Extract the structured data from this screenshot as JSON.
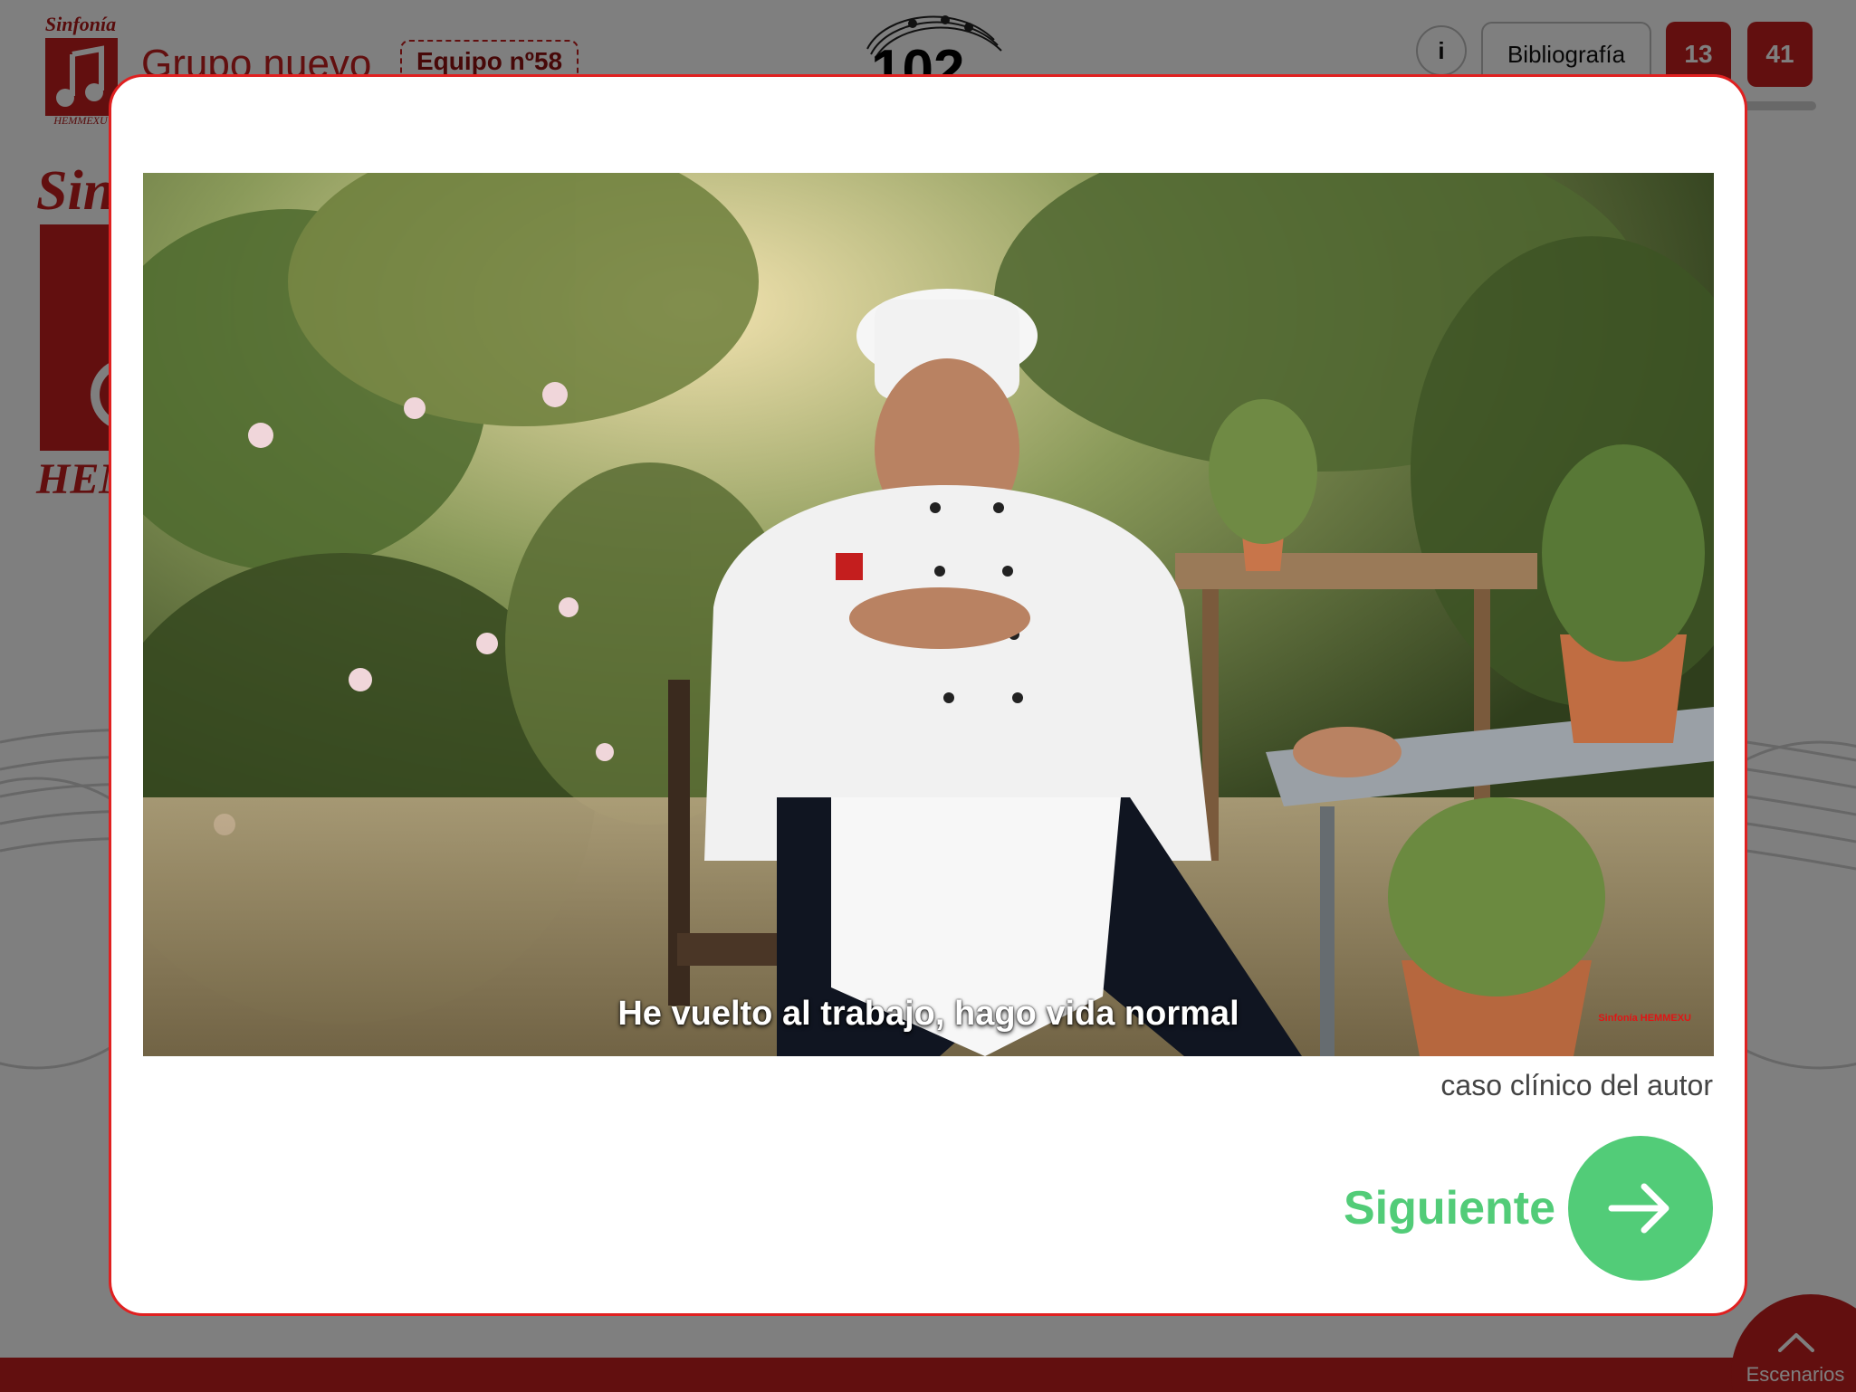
{
  "app": {
    "logo": {
      "top_text": "Sinfonía",
      "bottom_text": "HEMMEXU"
    },
    "group_title": "Grupo nuevo",
    "team_badge": "Equipo nº58",
    "counter": "102",
    "info_button": "i",
    "bibliography_button": "Bibliografía",
    "score_a": "13",
    "score_b": "41",
    "big_logo": {
      "top_text": "Sin",
      "bottom_text": "HEM"
    },
    "scenarios_label": "Escenarios"
  },
  "modal": {
    "video": {
      "subtitle": "He vuelto al trabajo, hago vida normal",
      "watermark": "Sinfonía HEMMEXU"
    },
    "caption": "caso clínico del autor",
    "next_label": "Siguiente",
    "icons": {
      "next": "arrow-right-icon",
      "scenarios": "chevron-up-icon",
      "info": "info-icon"
    }
  },
  "colors": {
    "brand_red": "#c41e1e",
    "modal_border": "#e02020",
    "next_green": "#52cc78"
  }
}
